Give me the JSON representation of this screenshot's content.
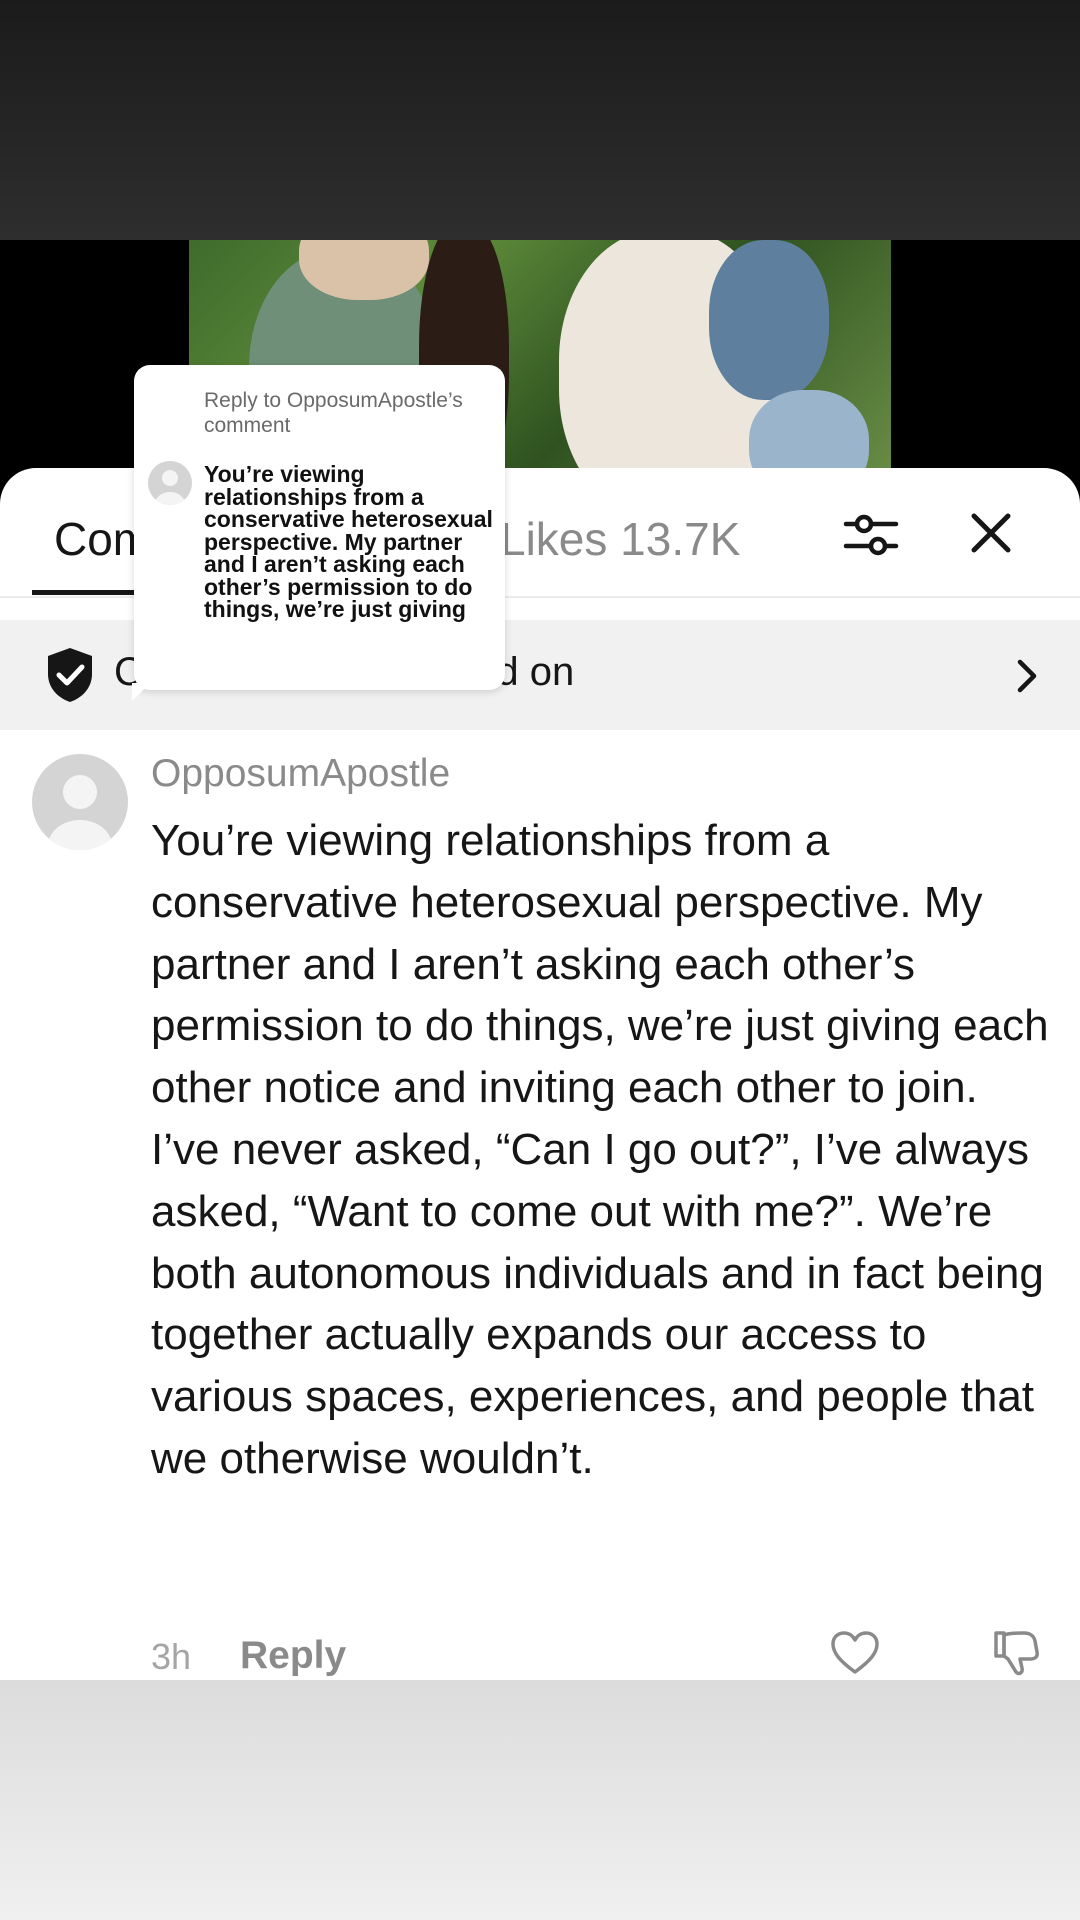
{
  "comments_panel": {
    "tab_comments_label": "Com",
    "tab_likes_label": "Likes 13.7K",
    "banner_text": "Comment filters turned on"
  },
  "comment": {
    "username": "OpposumApostle",
    "text": "You’re viewing relationships from a conservative heterosexual perspective. My partner and I aren’t asking each other’s permission to do things, we’re just giving each other notice and inviting each other to join. I’ve never asked, “Can I go out?”, I’ve always asked, “Want to come out with me?”. We’re both autonomous individuals and in fact being together actually expands our access to various spaces, experiences, and people that we otherwise wouldn’t.",
    "time": "3h",
    "reply_label": "Reply"
  },
  "reply_sticker": {
    "header": "Reply to OpposumApostle’s comment",
    "excerpt": "You’re viewing relationships from a conservative heterosexual perspective. My partner and I aren’t asking each other’s permission to do things, we’re just giving"
  },
  "icons": {
    "filter": "sliders-icon",
    "close": "close-icon",
    "shield": "shield-check-icon",
    "chevron": "chevron-right-icon",
    "like": "heart-icon",
    "dislike": "thumbs-down-icon"
  }
}
